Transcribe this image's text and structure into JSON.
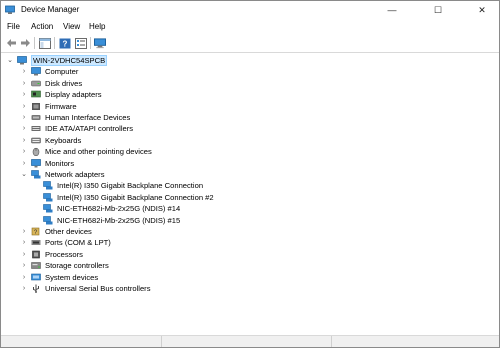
{
  "window": {
    "title": "Device Manager"
  },
  "menu": [
    "File",
    "Action",
    "View",
    "Help"
  ],
  "window_controls": {
    "minimize": "—",
    "maximize": "☐",
    "close": "✕"
  },
  "tree": {
    "root": "WIN-2VDHC54SPCB",
    "categories": [
      {
        "label": "Computer",
        "icon": "computer-icon"
      },
      {
        "label": "Disk drives",
        "icon": "disk-drive-icon"
      },
      {
        "label": "Display adapters",
        "icon": "display-adapter-icon"
      },
      {
        "label": "Firmware",
        "icon": "firmware-icon"
      },
      {
        "label": "Human Interface Devices",
        "icon": "hid-icon"
      },
      {
        "label": "IDE ATA/ATAPI controllers",
        "icon": "ide-controller-icon"
      },
      {
        "label": "Keyboards",
        "icon": "keyboard-icon"
      },
      {
        "label": "Mice and other pointing devices",
        "icon": "mouse-icon"
      },
      {
        "label": "Monitors",
        "icon": "monitor-icon"
      },
      {
        "label": "Network adapters",
        "icon": "network-adapter-icon",
        "expanded": true,
        "children": [
          "Intel(R) I350 Gigabit Backplane Connection",
          "Intel(R) I350 Gigabit Backplane Connection #2",
          "NIC-ETH682i-Mb-2x25G (NDIS) #14",
          "NIC-ETH682i-Mb-2x25G (NDIS) #15"
        ]
      },
      {
        "label": "Other devices",
        "icon": "other-devices-icon"
      },
      {
        "label": "Ports (COM & LPT)",
        "icon": "port-icon"
      },
      {
        "label": "Processors",
        "icon": "processor-icon"
      },
      {
        "label": "Storage controllers",
        "icon": "storage-controller-icon"
      },
      {
        "label": "System devices",
        "icon": "system-devices-icon"
      },
      {
        "label": "Universal Serial Bus controllers",
        "icon": "usb-icon"
      }
    ]
  },
  "colors": {
    "selection": "#cce8ff",
    "accent": "#1e7fd6"
  }
}
